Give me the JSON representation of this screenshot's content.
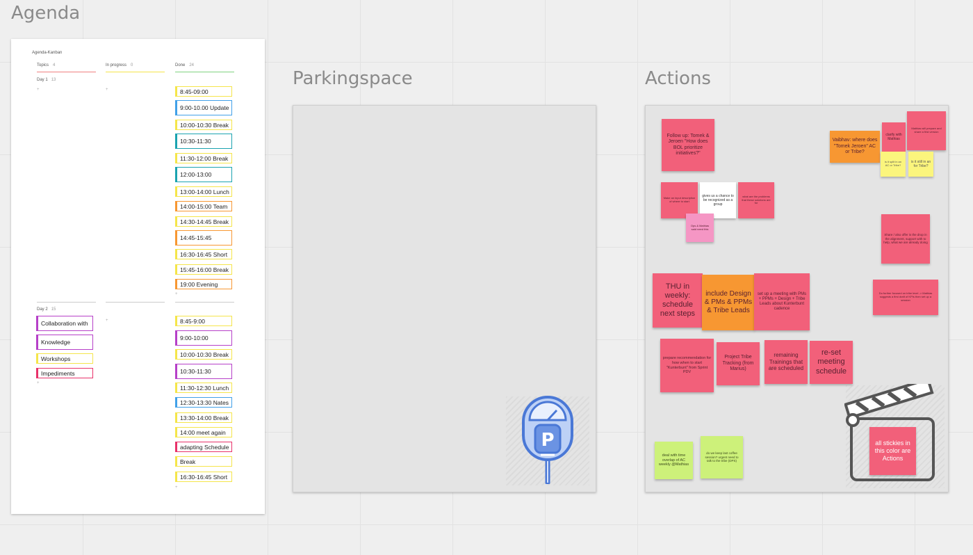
{
  "frames": {
    "agenda_title": "Agenda",
    "parking_title": "Parkingspace",
    "actions_title": "Actions"
  },
  "agenda": {
    "board_title": "Agenda-Kanban",
    "columns": [
      {
        "label": "Topics",
        "count": "4"
      },
      {
        "label": "In progress",
        "count": "0"
      },
      {
        "label": "Done",
        "count": "24"
      }
    ],
    "day1": {
      "label": "Day 1",
      "count": "13"
    },
    "day2": {
      "label": "Day 2",
      "count": "15"
    },
    "day1_done": [
      "8:45-09:00",
      "9:00-10.00 Update",
      "10:00-10:30 Break",
      "10:30-11:30",
      "11:30-12:00 Break",
      "12:00-13:00",
      "13:00-14:00 Lunch",
      "14:00-15:00 Team",
      "14:30-14:45 Break",
      "14:45-15:45",
      "16:30-16:45 Short",
      "15:45-16:00 Break",
      "19:00 Evening"
    ],
    "day2_topics": [
      "Collaboration with",
      "Knowledge",
      "Workshops",
      "Impediments"
    ],
    "day2_done": [
      "8:45-9:00",
      "9:00-10:00",
      "10:00-10:30 Break",
      "10:30-11:30",
      "11:30-12:30 Lunch",
      "12:30-13:30 Nates",
      "13:30-14:00 Break",
      "14:00 meet again",
      "adapting Schedule",
      "Break",
      "16:30-16:45 Short"
    ]
  },
  "actions": {
    "stickies": [
      "Follow up: Tomek & Jeroen \"How does BOL prioritize initiatives?\"",
      "Vaibhav: where does \"Tomek Jeroen\" AC or Tribe?",
      "clarify with Mathias",
      "Mathias will prepare and share a first version",
      "is it split in an AC or Tribe?",
      "is it still in an for Tribe?",
      "Make an input description of where to start",
      "gives us a chance to be recognized as a group",
      "what are the problems that these solutions are for",
      "Ops & Mathias said need this",
      "Share / also offer is the drop in the alignment, support with to help, what we are already doing",
      "Do further focused on tribe level -> Mathias suggests a first draft of KPIs then set up a session",
      "THU in weekly: schedule next steps",
      "include Design & PMs & PPMs & Tribe Leads",
      "set up a meeting with PMs + PPMs + Design + Tribe Leads about Kunterbunt cadence",
      "prepare recommendation for how when to start \"Kunterbunt\" from Sprint PDV",
      "Project Tribe Tracking (from Marius)",
      "remaining Trainings that are scheduled",
      "re-set meeting schedule",
      "deal with time overlap of AC weekly @Mathias",
      "do we keep last coffee session? urgent need to talk to the tribe (DPS)",
      "all stickies in this color are Actions"
    ]
  },
  "colors": {
    "action_pink": "#f2607a",
    "orange": "#f79732",
    "yellow": "#fbf57d",
    "lime": "#cdf17a",
    "meter_blue": "#4a78d6"
  },
  "icons": [
    "parking-meter-icon",
    "clapperboard-icon"
  ]
}
